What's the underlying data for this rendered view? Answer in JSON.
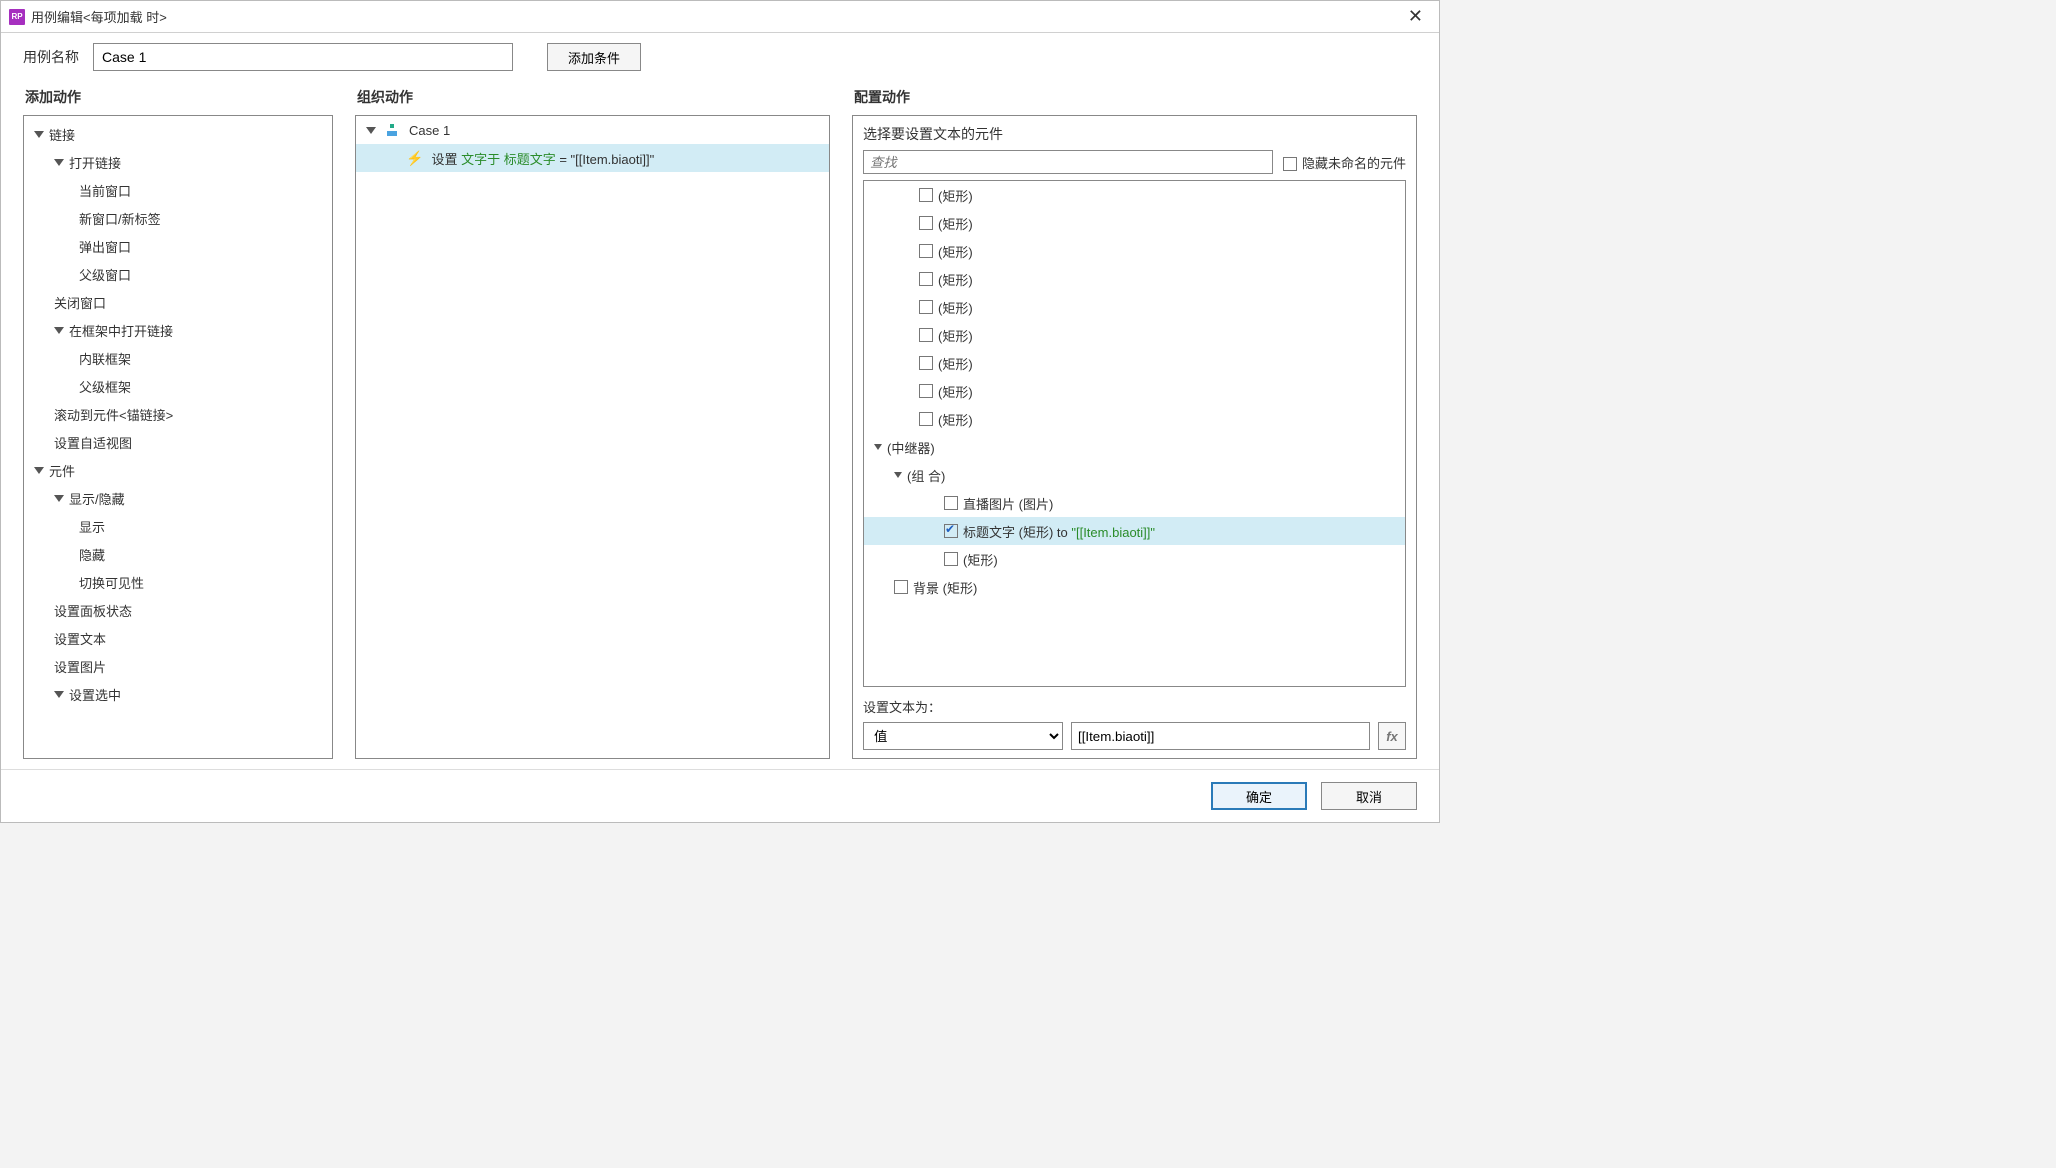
{
  "titlebar": {
    "text": "用例编辑<每项加载 时>"
  },
  "case_name": {
    "label": "用例名称",
    "value": "Case 1"
  },
  "add_condition_btn": "添加条件",
  "columns": {
    "actions_title": "添加动作",
    "organize_title": "组织动作",
    "config_title": "配置动作"
  },
  "actions_tree": [
    {
      "level": 0,
      "expandable": true,
      "label": "链接"
    },
    {
      "level": 1,
      "expandable": true,
      "label": "打开链接"
    },
    {
      "level": 2,
      "label": "当前窗口"
    },
    {
      "level": 2,
      "label": "新窗口/新标签"
    },
    {
      "level": 2,
      "label": "弹出窗口"
    },
    {
      "level": 2,
      "label": "父级窗口"
    },
    {
      "level": 1,
      "label": "关闭窗口"
    },
    {
      "level": 1,
      "expandable": true,
      "label": "在框架中打开链接"
    },
    {
      "level": 2,
      "label": "内联框架"
    },
    {
      "level": 2,
      "label": "父级框架"
    },
    {
      "level": 1,
      "label": "滚动到元件<锚链接>"
    },
    {
      "level": 1,
      "label": "设置自适视图"
    },
    {
      "level": 0,
      "expandable": true,
      "label": "元件"
    },
    {
      "level": 1,
      "expandable": true,
      "label": "显示/隐藏"
    },
    {
      "level": 2,
      "label": "显示"
    },
    {
      "level": 2,
      "label": "隐藏"
    },
    {
      "level": 2,
      "label": "切换可见性"
    },
    {
      "level": 1,
      "label": "设置面板状态"
    },
    {
      "level": 1,
      "label": "设置文本"
    },
    {
      "level": 1,
      "label": "设置图片"
    },
    {
      "level": 1,
      "expandable": true,
      "label": "设置选中"
    }
  ],
  "organize": {
    "case_label": "Case 1",
    "action_prefix": "设置 ",
    "action_green1": "文字于",
    "action_mid": " ",
    "action_green2": "标题文字",
    "action_suffix": " = \"[[Item.biaoti]]\""
  },
  "config": {
    "select_widget_label": "选择要设置文本的元件",
    "search_placeholder": "查找",
    "hide_unnamed_label": "隐藏未命名的元件",
    "rect_label": "(矩形)",
    "repeater_label": "(中继器)",
    "group_label": "(组 合)",
    "item_image": "直播图片 (图片)",
    "item_title_prefix": "标题文字 (矩形) ",
    "item_title_to": "to ",
    "item_title_val": "\"[[Item.biaoti]]\"",
    "item_rect": "(矩形)",
    "item_bg": "背景 (矩形)",
    "set_text_label": "设置文本为：",
    "value_option": "值",
    "value_text": "[[Item.biaoti]]"
  },
  "footer": {
    "ok": "确定",
    "cancel": "取消"
  }
}
